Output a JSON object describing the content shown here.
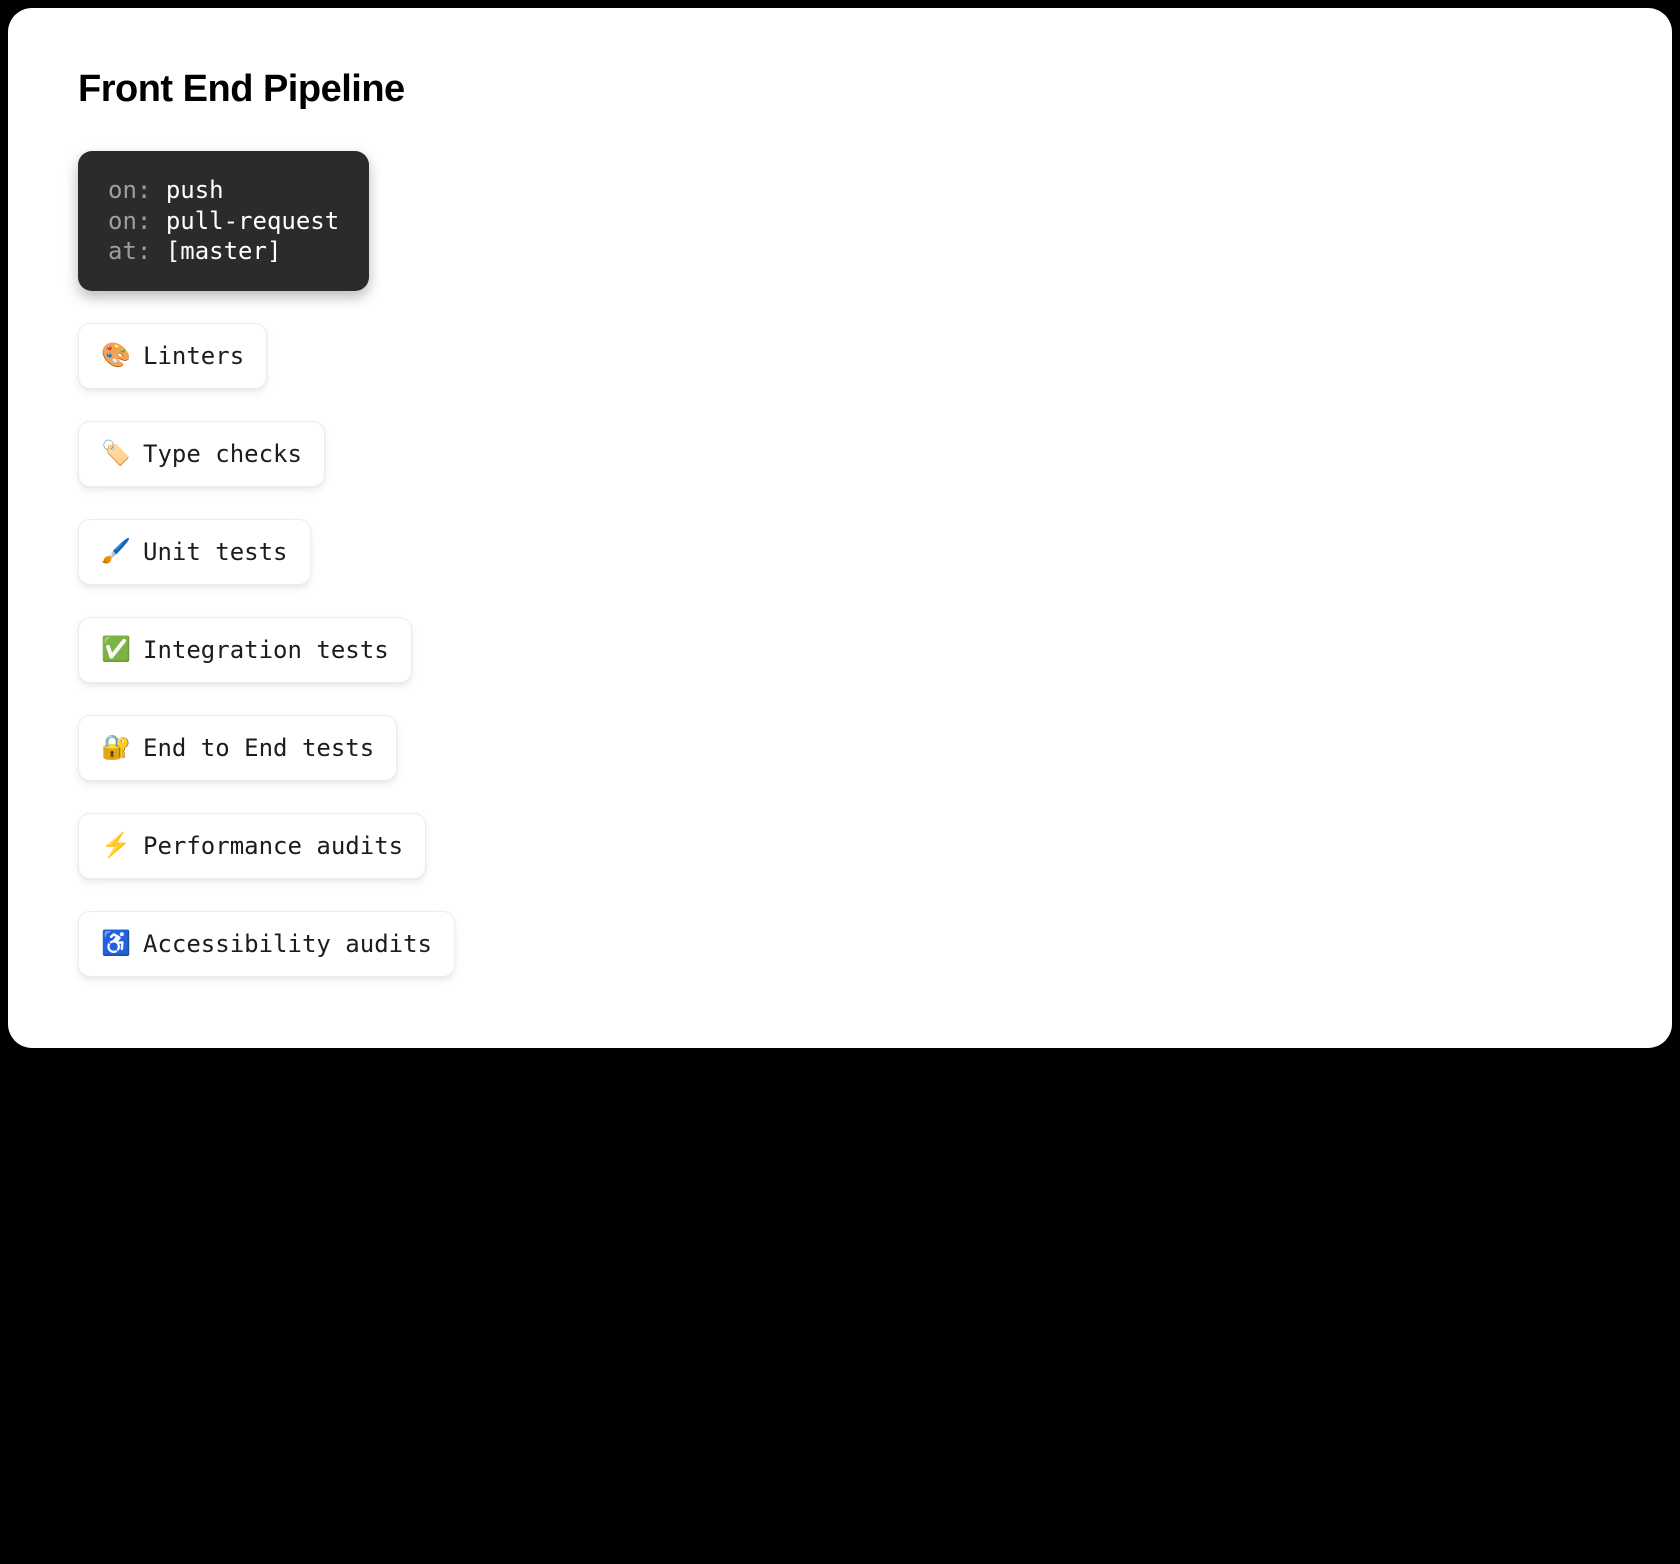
{
  "title": "Front End Pipeline",
  "triggers": [
    {
      "key": "on:",
      "value": "push"
    },
    {
      "key": "on:",
      "value": "pull-request"
    },
    {
      "key": "at:",
      "value": "[master]"
    }
  ],
  "steps": [
    {
      "icon": "🎨",
      "label": "Linters"
    },
    {
      "icon": "🏷️",
      "label": "Type checks"
    },
    {
      "icon": "🖌️",
      "label": "Unit tests"
    },
    {
      "icon": "✅",
      "label": "Integration tests"
    },
    {
      "icon": "🔐",
      "label": "End to End tests"
    },
    {
      "icon": "⚡",
      "label": "Performance audits"
    },
    {
      "icon": "♿",
      "label": "Accessibility audits"
    }
  ]
}
